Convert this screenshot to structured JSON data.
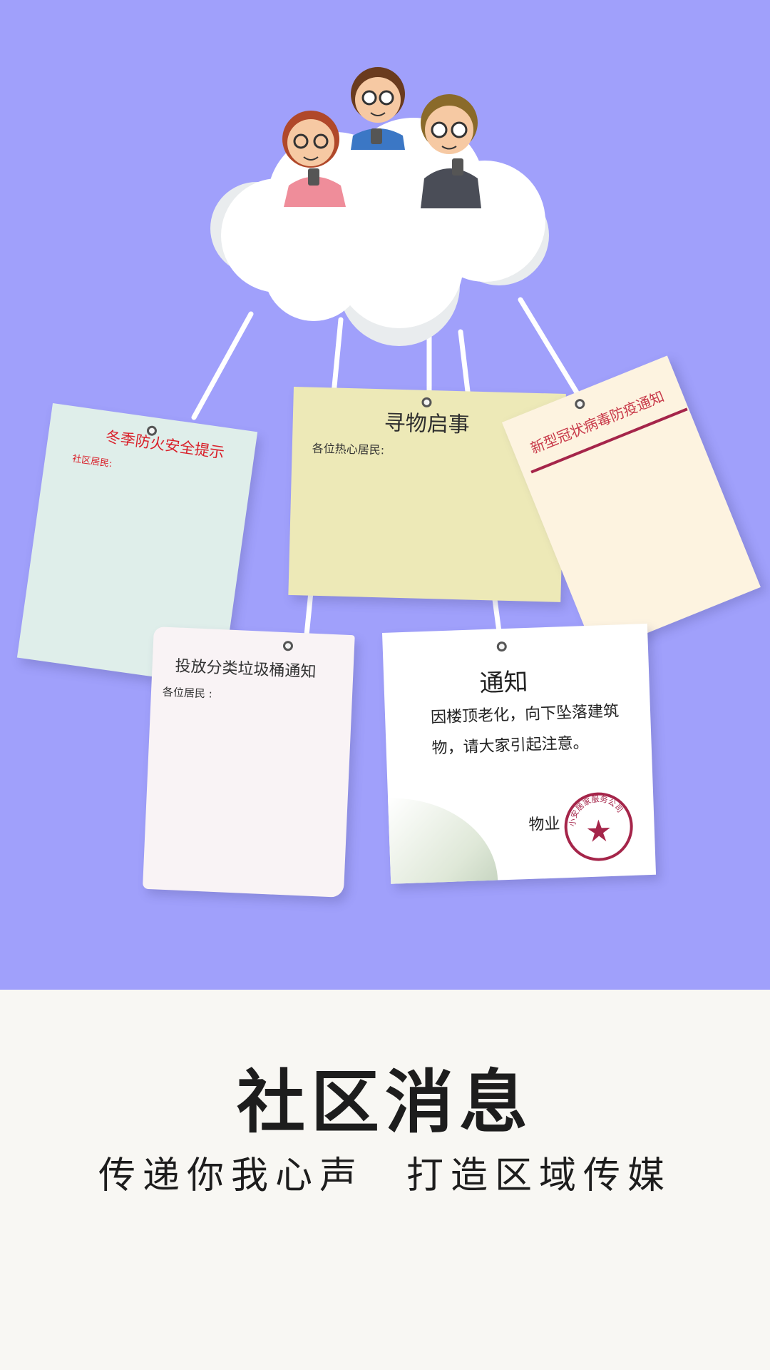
{
  "notes": {
    "fire": {
      "title": "冬季防火安全提示",
      "greeting": "社区居民:"
    },
    "lost": {
      "title": "寻物启事",
      "greeting": "各位热心居民:"
    },
    "covid": {
      "title": "新型冠状病毒防疫通知"
    },
    "trash": {
      "title": "投放分类垃圾桶通知",
      "greeting": "各位居民 :"
    },
    "notice": {
      "title": "通知",
      "body": "因楼顶老化，向下坠落建筑物，请大家引起注意。",
      "signature": "物业",
      "stamp_text": "小安居家服务公司"
    }
  },
  "headline": "社区消息",
  "slogan": {
    "part1": "传递你我心声",
    "part2": "打造区域传媒"
  },
  "colors": {
    "hero_background": "#a0a0fb",
    "page_background": "#f8f7f3",
    "red_text": "#d9202a",
    "stamp_red": "#a5254a"
  }
}
